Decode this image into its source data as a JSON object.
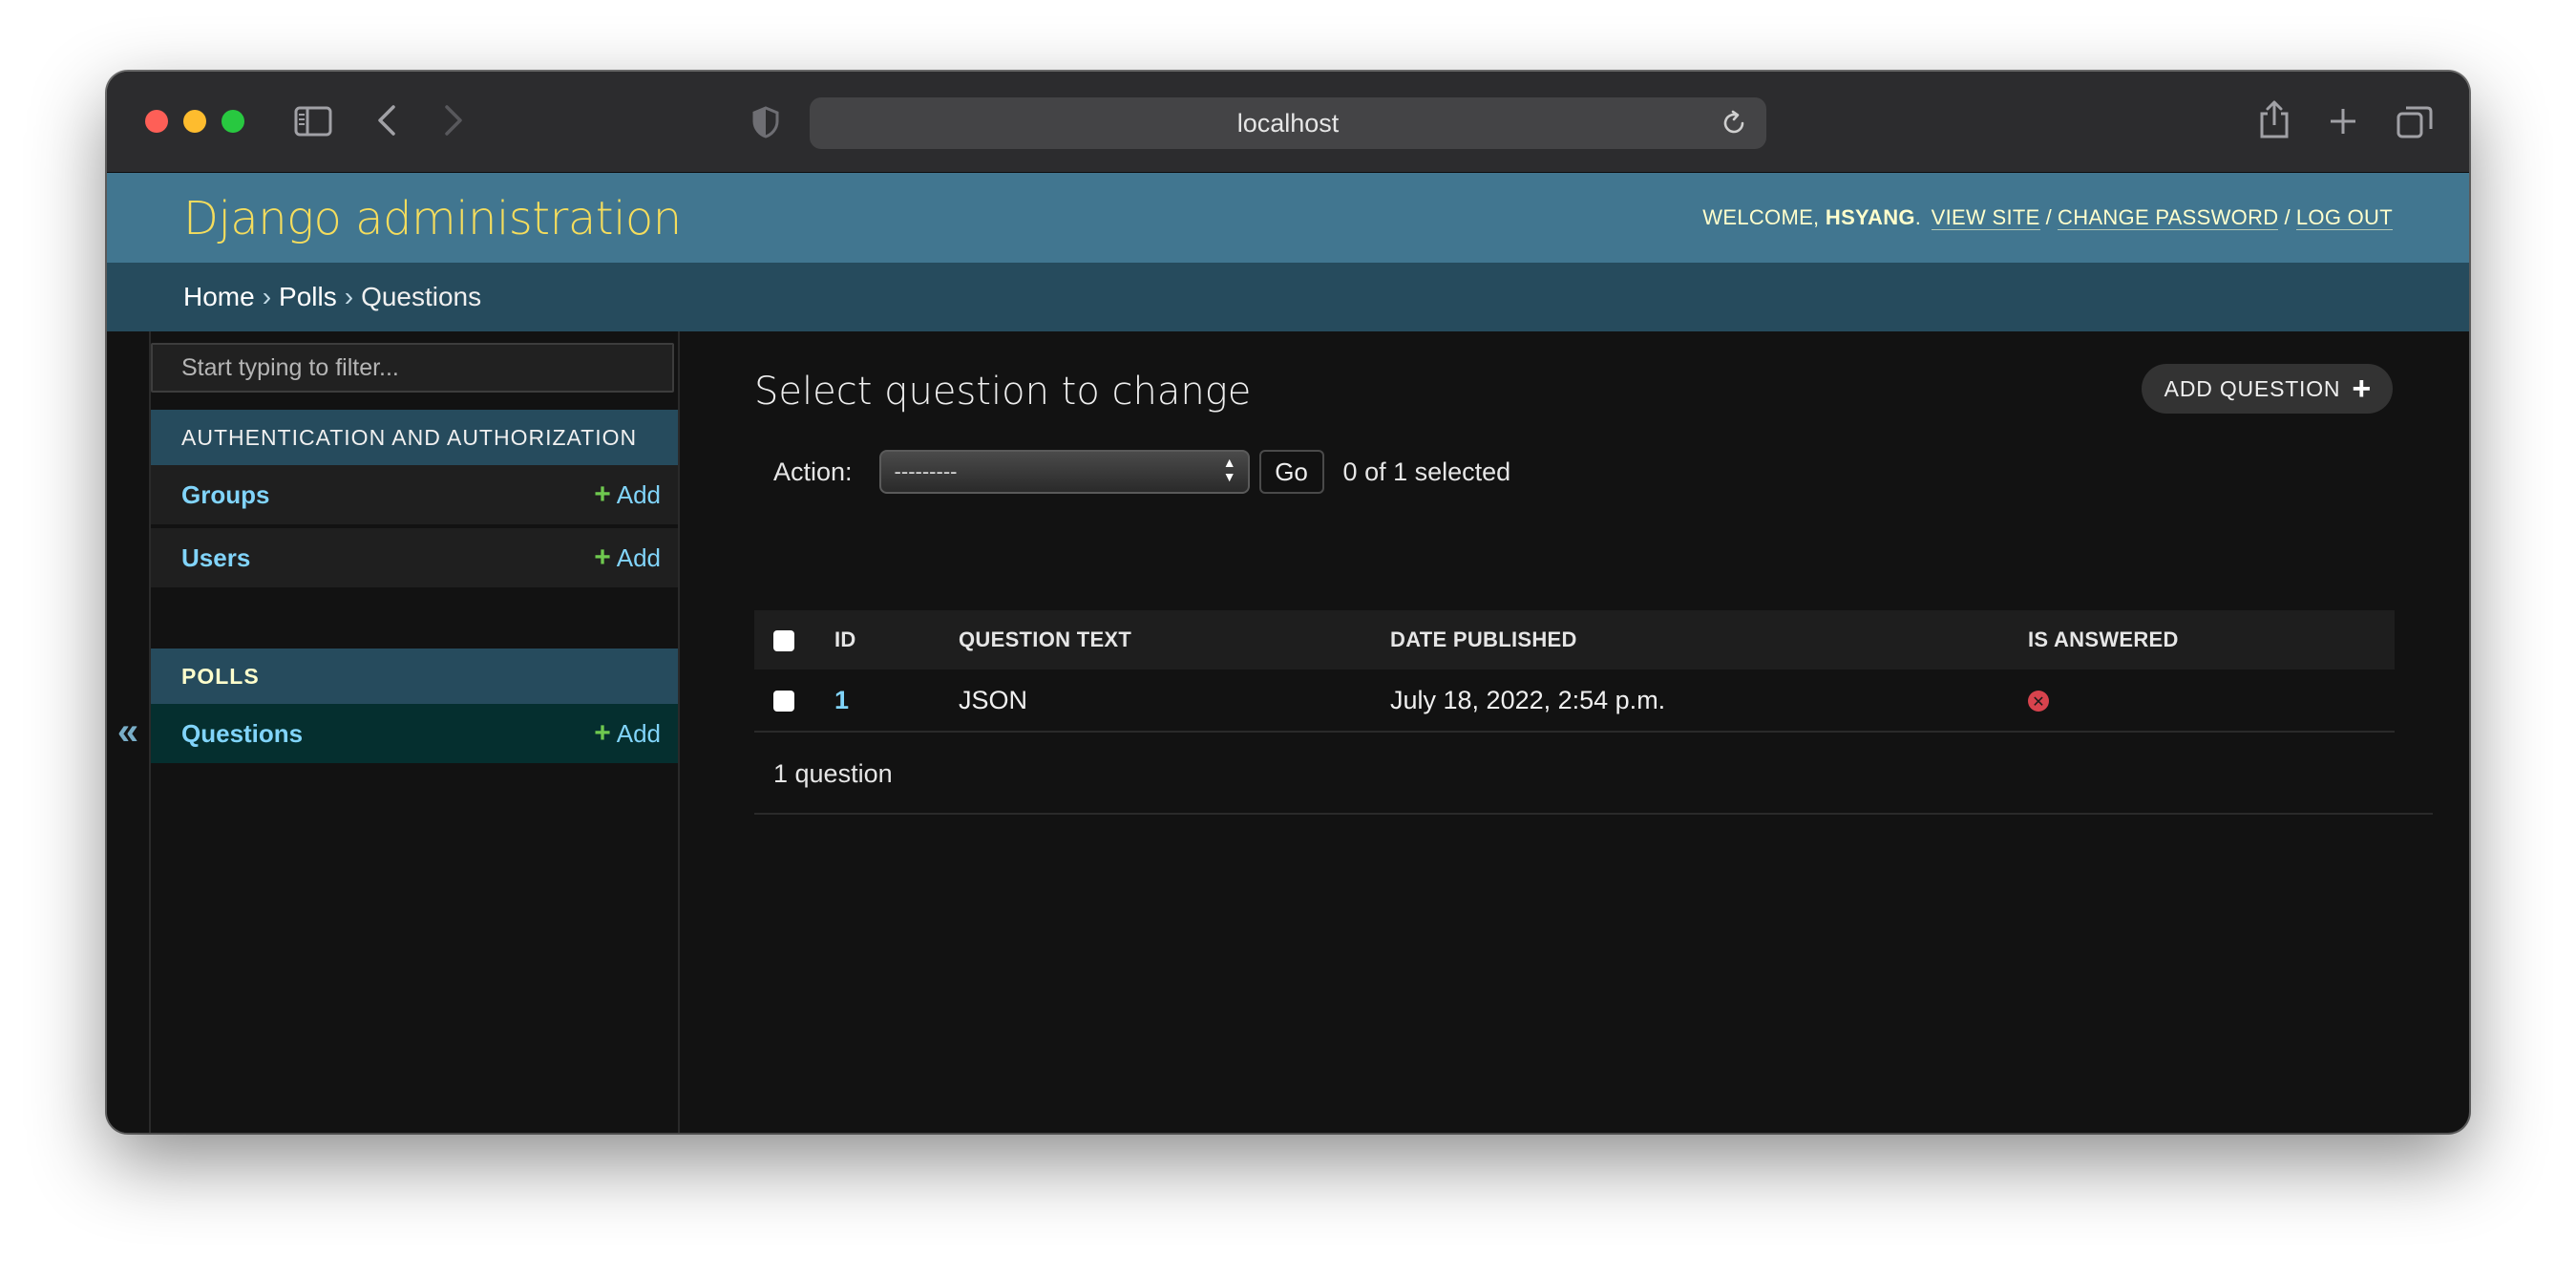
{
  "browser": {
    "url": "localhost"
  },
  "header": {
    "branding": "Django administration",
    "welcome": "WELCOME,",
    "username": "HSYANG",
    "view_site": "VIEW SITE",
    "change_password": "CHANGE PASSWORD",
    "log_out": "LOG OUT"
  },
  "breadcrumbs": {
    "home": "Home",
    "polls": "Polls",
    "current": "Questions"
  },
  "sidebar": {
    "toggle": "«",
    "filter_placeholder": "Start typing to filter...",
    "apps": [
      {
        "caption": "AUTHENTICATION AND AUTHORIZATION",
        "models": [
          {
            "name": "Groups",
            "add": "Add"
          },
          {
            "name": "Users",
            "add": "Add"
          }
        ]
      },
      {
        "caption": "POLLS",
        "models": [
          {
            "name": "Questions",
            "add": "Add"
          }
        ]
      }
    ]
  },
  "main": {
    "title": "Select question to change",
    "add_button": "ADD QUESTION",
    "action_label": "Action:",
    "action_selected": "---------",
    "go_button": "Go",
    "selection_counter": "0 of 1 selected",
    "columns": [
      "ID",
      "QUESTION TEXT",
      "DATE PUBLISHED",
      "IS ANSWERED"
    ],
    "rows": [
      {
        "id": "1",
        "question_text": "JSON",
        "date_published": "July 18, 2022, 2:54 p.m.",
        "is_answered": "no"
      }
    ],
    "paginator": "1 question"
  },
  "colors": {
    "header_bg": "#417690",
    "breadcrumb_bg": "#264b5d",
    "branding": "#f5dd5d",
    "link": "#81d4fa",
    "add_green": "#6fc94f",
    "false_icon": "#d8434d"
  }
}
